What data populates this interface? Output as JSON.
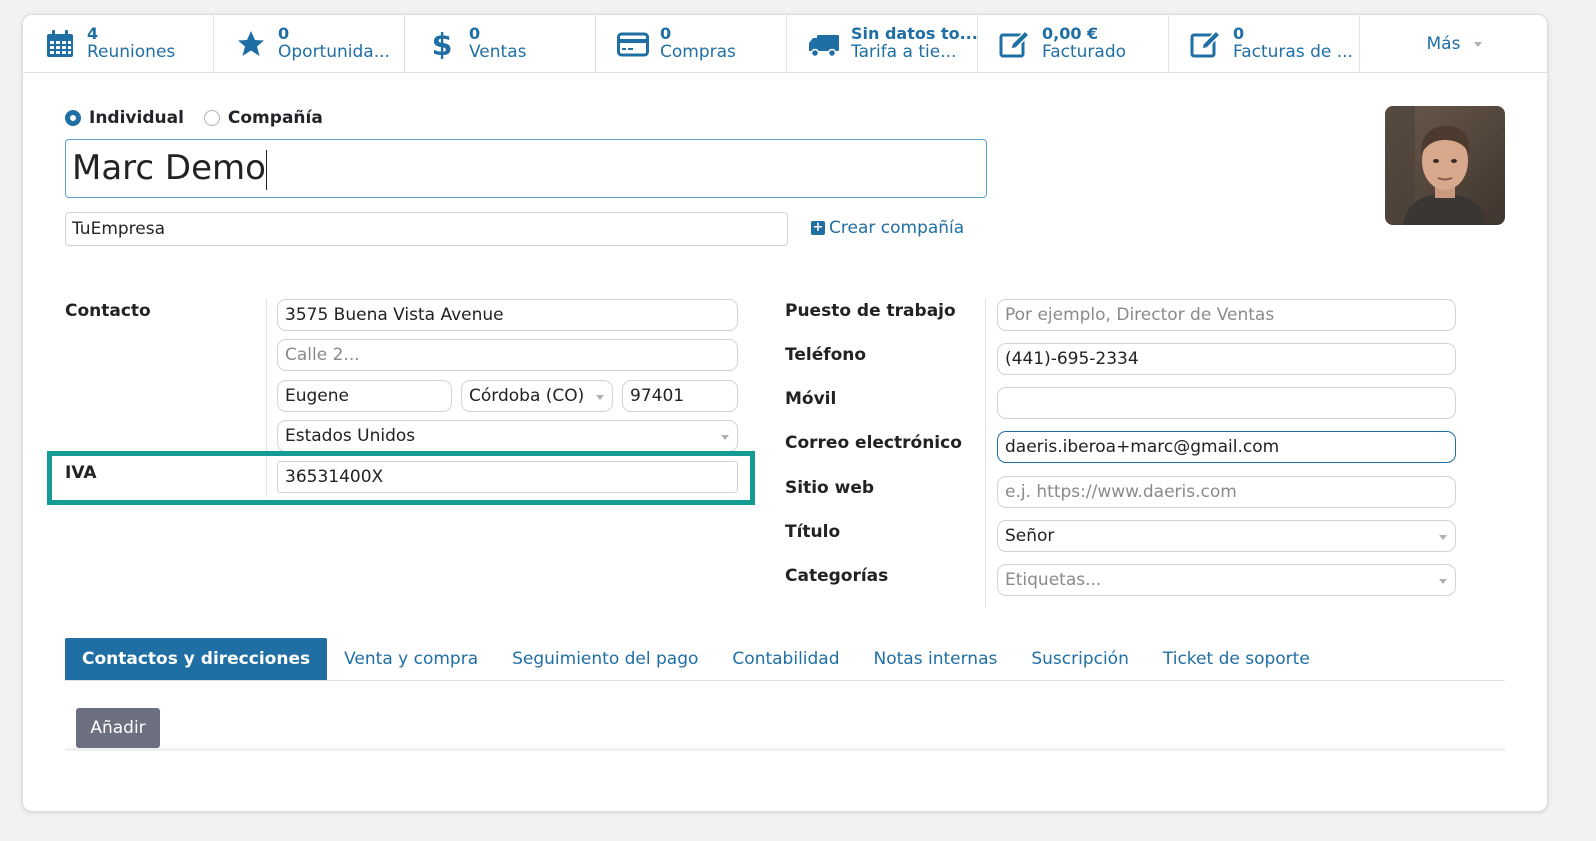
{
  "stat_buttons": [
    {
      "icon": "calendar-icon",
      "value": "4",
      "label": "Reuniones"
    },
    {
      "icon": "star-icon",
      "value": "0",
      "label": "Oportunida..."
    },
    {
      "icon": "dollar-icon",
      "value": "0",
      "label": "Ventas"
    },
    {
      "icon": "credit-card-icon",
      "value": "0",
      "label": "Compras"
    },
    {
      "icon": "truck-icon",
      "value": "Sin datos to...",
      "label": "Tarifa a tie..."
    },
    {
      "icon": "edit-icon",
      "value": "0,00 €",
      "label": "Facturado"
    },
    {
      "icon": "edit-icon",
      "value": "0",
      "label": "Facturas de ..."
    }
  ],
  "more_label": "Más",
  "partner_type": {
    "individual": "Individual",
    "company": "Compañía",
    "selected": "individual"
  },
  "name": "Marc Demo",
  "company": "TuEmpresa",
  "create_company_label": "Crear compañía",
  "left_fields": {
    "contact_label": "Contacto",
    "street": "3575  Buena Vista Avenue",
    "street2_placeholder": "Calle 2...",
    "city": "Eugene",
    "state": "Córdoba (CO)",
    "zip": "97401",
    "country": "Estados Unidos",
    "vat_label": "IVA",
    "vat": "36531400X"
  },
  "right_fields": {
    "job_label": "Puesto de trabajo",
    "job_placeholder": "Por ejemplo, Director de Ventas",
    "phone_label": "Teléfono",
    "phone": "(441)-695-2334",
    "mobile_label": "Móvil",
    "mobile": "",
    "email_label": "Correo electrónico",
    "email": "daeris.iberoa+marc@gmail.com",
    "website_label": "Sitio web",
    "website_placeholder": "e.j. https://www.daeris.com",
    "title_label": "Título",
    "title": "Señor",
    "tags_label": "Categorías",
    "tags_placeholder": "Etiquetas..."
  },
  "tabs": [
    "Contactos y direcciones",
    "Venta y compra",
    "Seguimiento del pago",
    "Contabilidad",
    "Notas internas",
    "Suscripción",
    "Ticket de soporte"
  ],
  "add_button": "Añadir",
  "colors": {
    "accent": "#1f6fa5",
    "highlight": "#149c94",
    "button_grey": "#6c6f80"
  }
}
